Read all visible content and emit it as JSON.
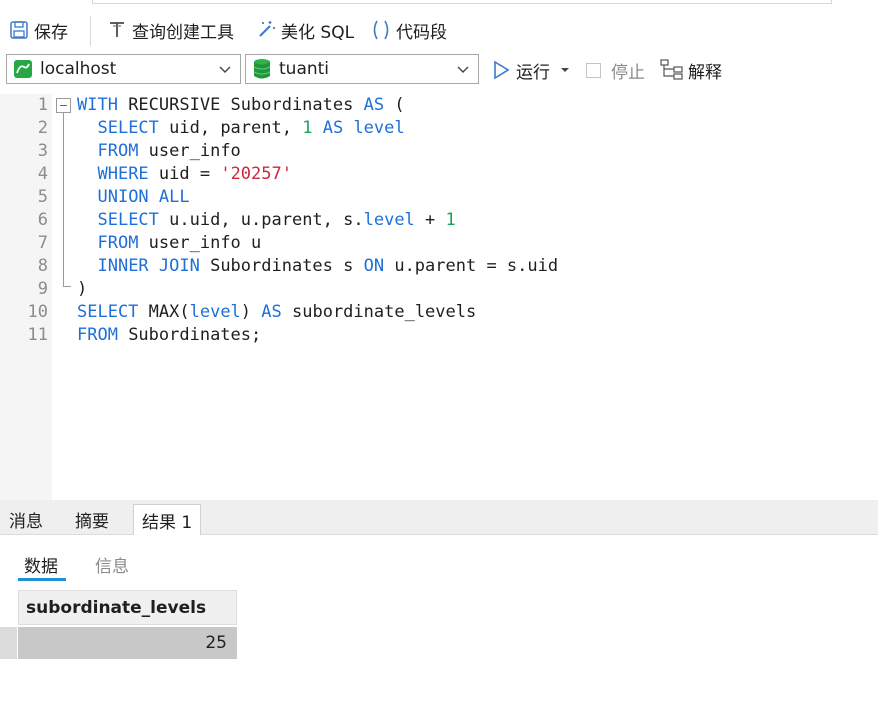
{
  "toolbar": {
    "save": "保存",
    "query_builder": "查询创建工具",
    "beautify_sql": "美化 SQL",
    "code_snippet": "代码段"
  },
  "connection": {
    "server": "localhost",
    "database": "tuanti"
  },
  "actions": {
    "run": "运行",
    "stop": "停止",
    "explain": "解释"
  },
  "editor": {
    "line_numbers": [
      "1",
      "2",
      "3",
      "4",
      "5",
      "6",
      "7",
      "8",
      "9",
      "10",
      "11"
    ]
  },
  "bottom_tabs": {
    "messages": "消息",
    "summary": "摘要",
    "result": "结果 1"
  },
  "sub_tabs": {
    "data": "数据",
    "info": "信息"
  },
  "result_grid": {
    "columns": [
      "subordinate_levels"
    ],
    "rows": [
      [
        "25"
      ]
    ]
  },
  "colors": {
    "keyword": "#1e6fd9",
    "number": "#19a35a",
    "string": "#d0263c",
    "accent": "#1e8fd9"
  }
}
